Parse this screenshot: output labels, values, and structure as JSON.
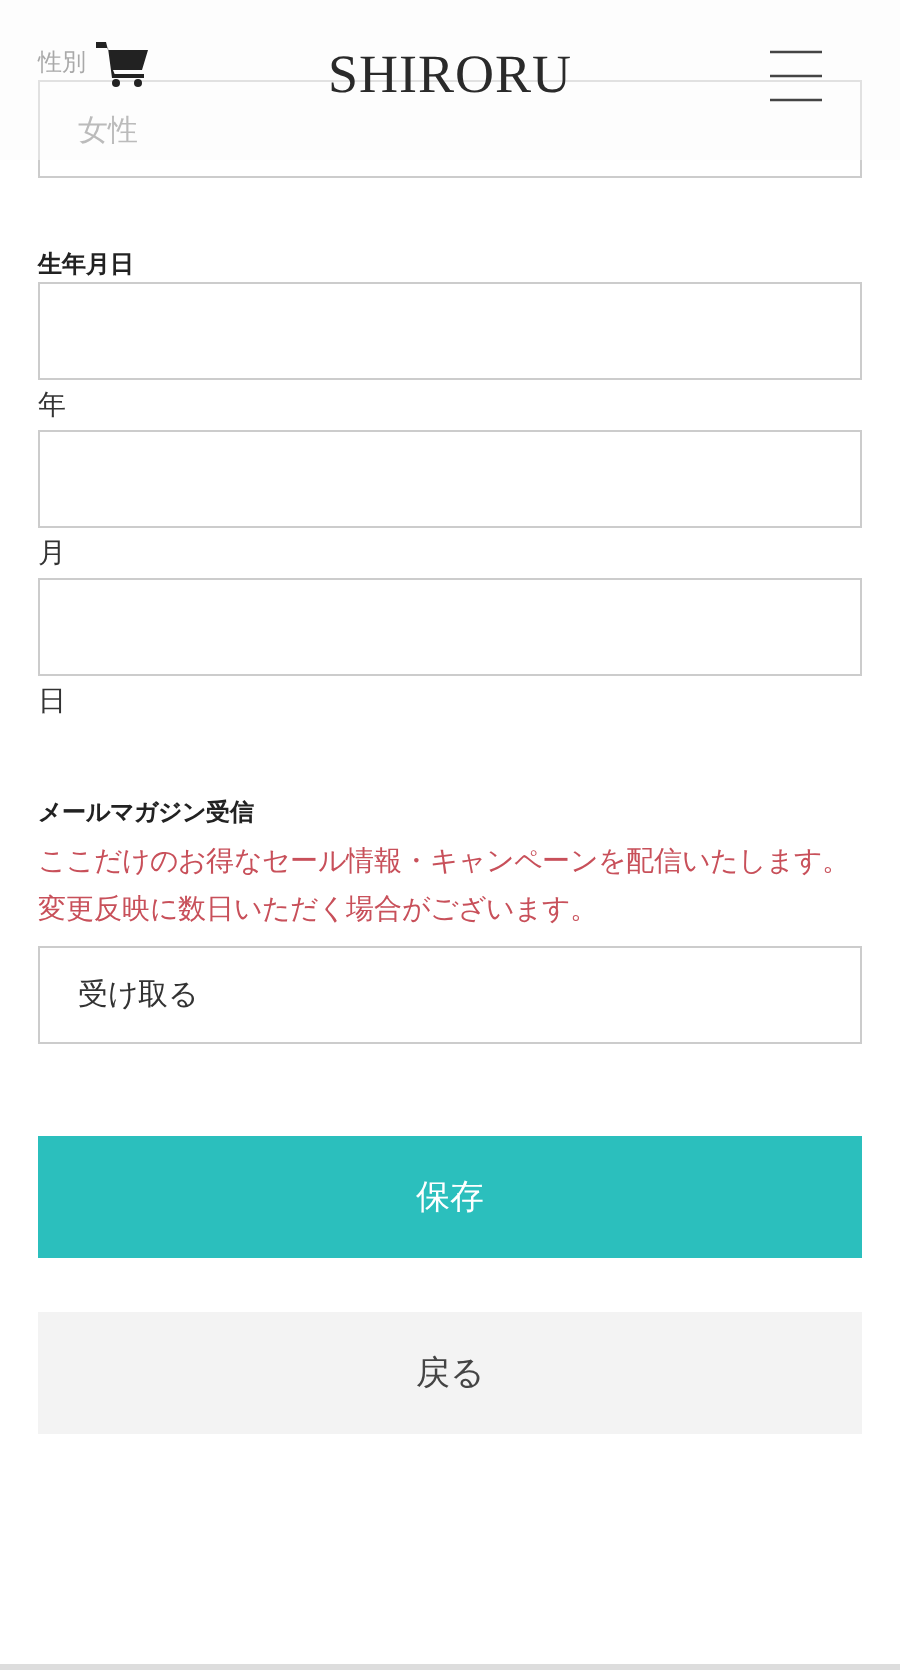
{
  "header": {
    "logo": "SHIRORU"
  },
  "gender": {
    "label": "性別",
    "placeholder": "女性"
  },
  "birthday": {
    "label": "生年月日",
    "fields": [
      {
        "suffix": "年"
      },
      {
        "suffix": "月"
      },
      {
        "suffix": "日"
      }
    ]
  },
  "newsletter": {
    "label": "メールマガジン受信",
    "notice": [
      "ここだけのお得なセール情報・キャンペーンを配信いたします。",
      "変更反映に数日いただく場合がございます。"
    ],
    "value": "受け取る"
  },
  "buttons": [
    {
      "label": "保存",
      "kind": "primary"
    },
    {
      "label": "戻る",
      "kind": "secondary"
    }
  ]
}
